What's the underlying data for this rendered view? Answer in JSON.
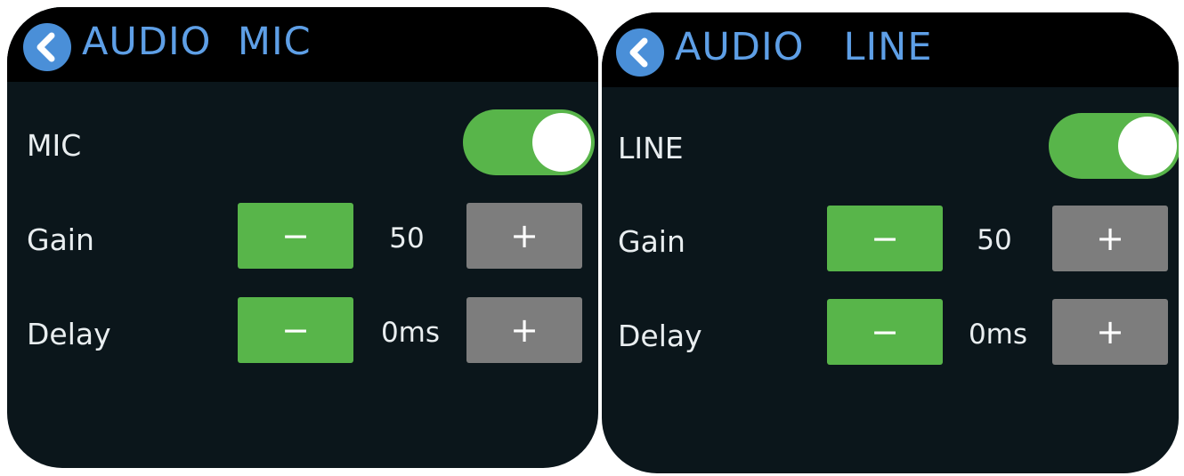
{
  "screens": [
    {
      "title": "AUDIO  MIC",
      "toggle": {
        "label": "MIC",
        "on": true
      },
      "gain": {
        "label": "Gain",
        "value": "50",
        "minus": "−",
        "plus": "+"
      },
      "delay": {
        "label": "Delay",
        "value": "0ms",
        "minus": "−",
        "plus": "+"
      }
    },
    {
      "title": "AUDIO   LINE",
      "toggle": {
        "label": "LINE",
        "on": true
      },
      "gain": {
        "label": "Gain",
        "value": "50",
        "minus": "−",
        "plus": "+"
      },
      "delay": {
        "label": "Delay",
        "value": "0ms",
        "minus": "−",
        "plus": "+"
      }
    }
  ],
  "colors": {
    "background": "#0b161b",
    "header": "#000000",
    "accent_blue": "#4a8fd8",
    "toggle_on": "#58b54a",
    "minus_button": "#58b54a",
    "plus_button": "#7d7d7d"
  },
  "icons": {
    "back": "chevron-left-icon"
  }
}
